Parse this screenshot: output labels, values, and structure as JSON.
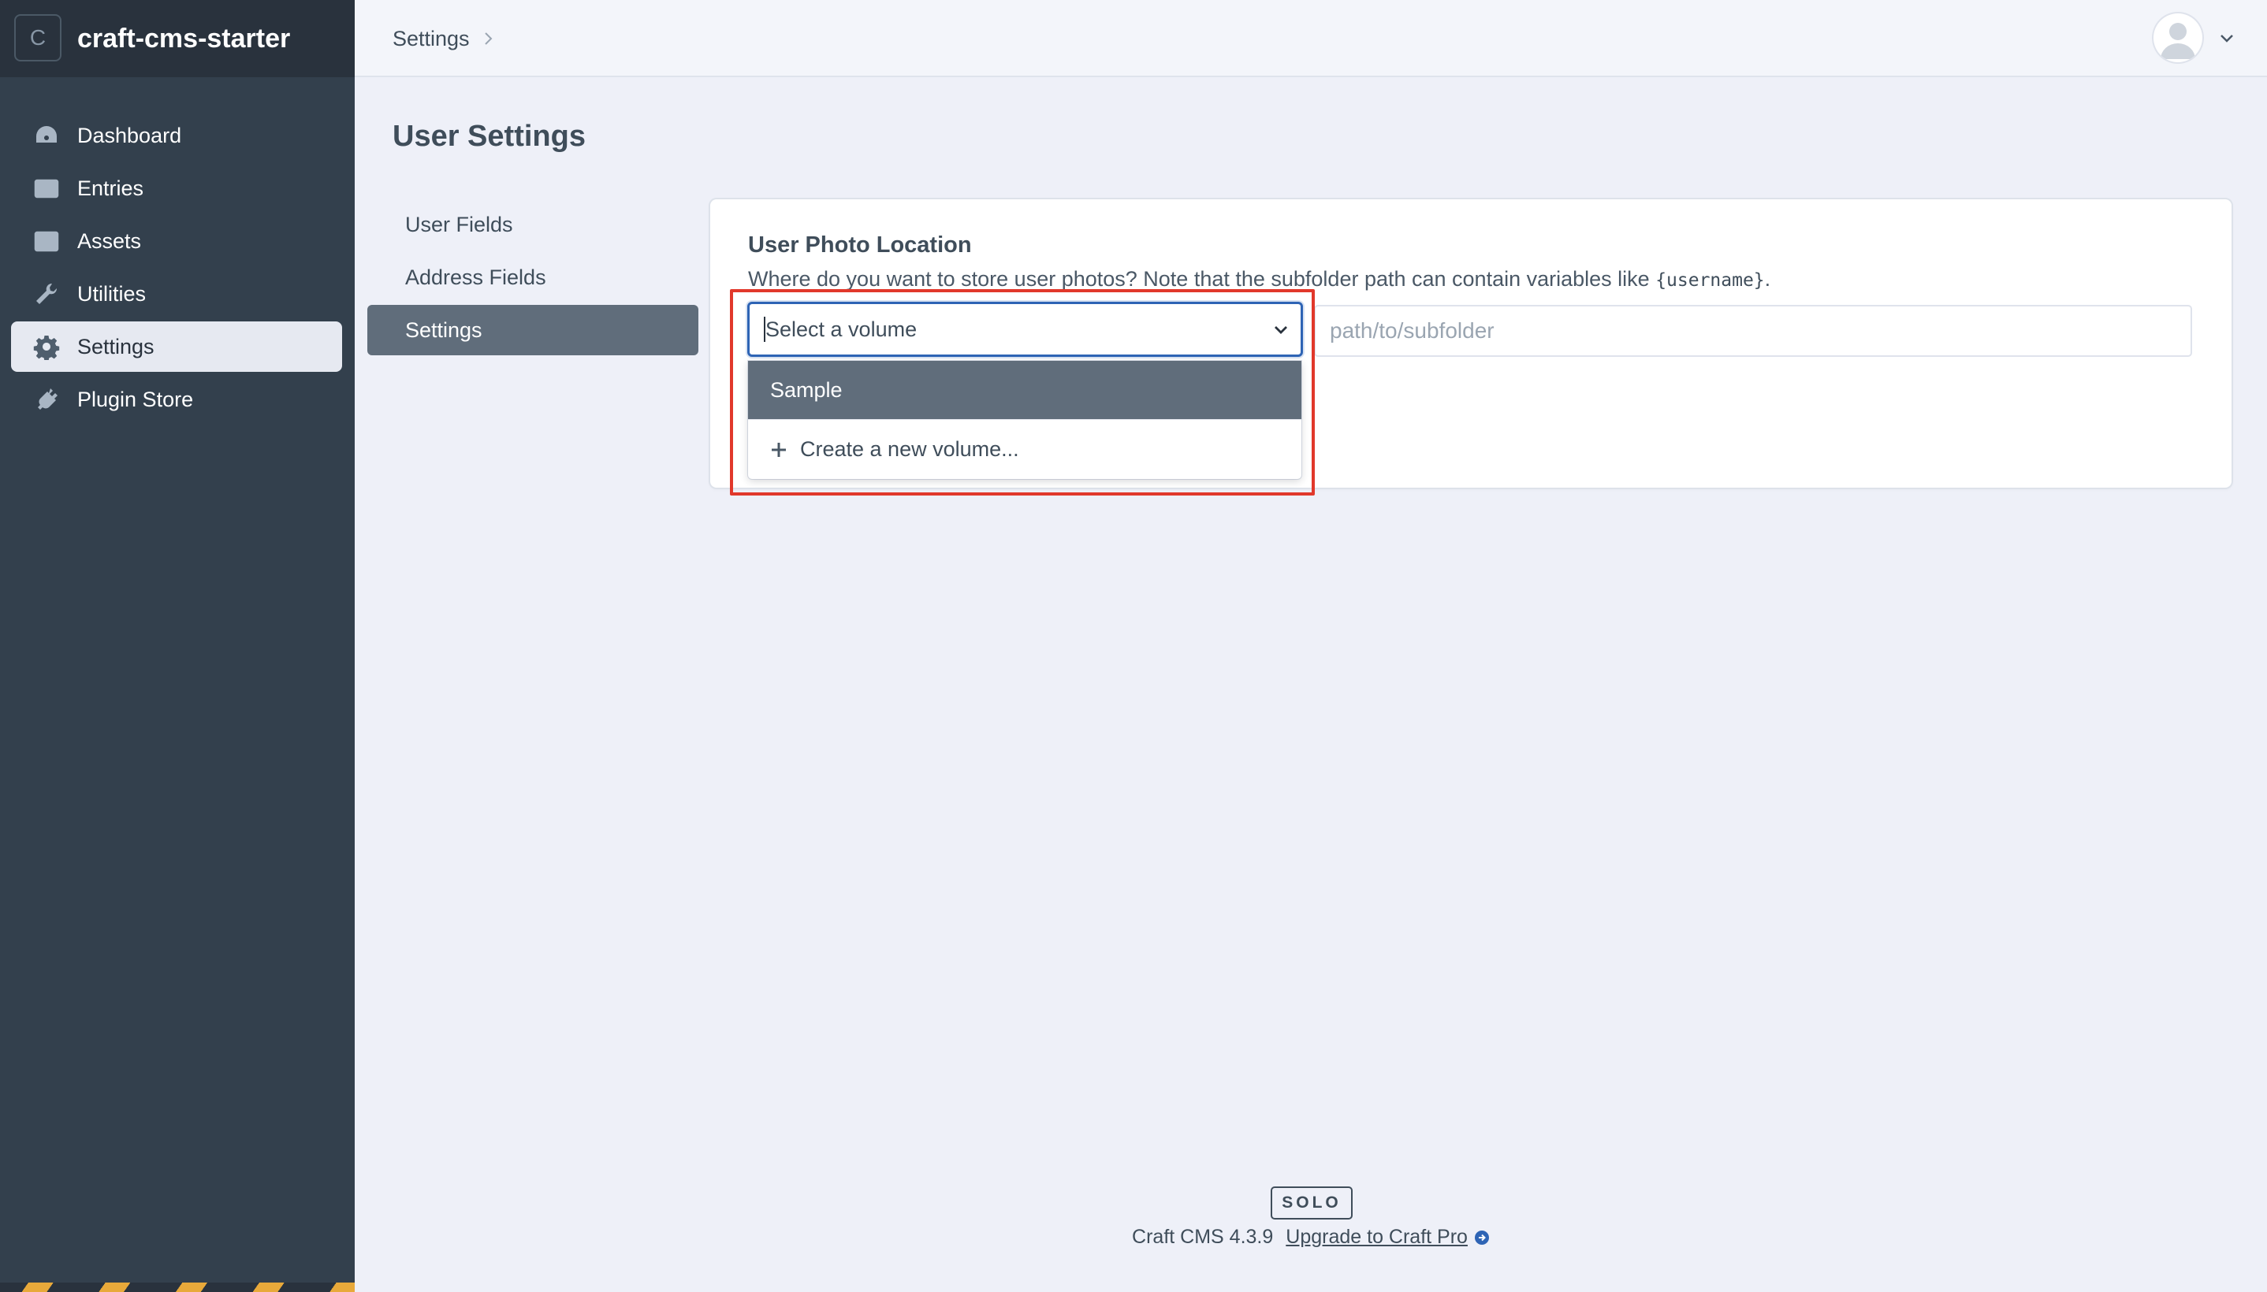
{
  "site": {
    "badge_letter": "C",
    "name": "craft-cms-starter"
  },
  "nav": {
    "items": [
      {
        "label": "Dashboard",
        "icon": "gauge-icon"
      },
      {
        "label": "Entries",
        "icon": "newspaper-icon"
      },
      {
        "label": "Assets",
        "icon": "image-icon"
      },
      {
        "label": "Utilities",
        "icon": "wrench-icon"
      },
      {
        "label": "Settings",
        "icon": "gear-icon",
        "active": true
      },
      {
        "label": "Plugin Store",
        "icon": "plug-icon"
      }
    ]
  },
  "topbar": {
    "breadcrumb": "Settings"
  },
  "page": {
    "title": "User Settings"
  },
  "subnav": {
    "items": [
      {
        "label": "User Fields"
      },
      {
        "label": "Address Fields"
      },
      {
        "label": "Settings",
        "active": true
      }
    ]
  },
  "photo_location": {
    "label": "User Photo Location",
    "instructions_prefix": "Where do you want to store user photos? Note that the subfolder path can contain variables like ",
    "instructions_code": "{username}",
    "instructions_suffix": ".",
    "volume_select": {
      "value": "Select a volume"
    },
    "subfolder": {
      "placeholder": "path/to/subfolder",
      "value": ""
    },
    "dropdown_options": [
      {
        "label": "Sample",
        "highlighted": true
      },
      {
        "label": "Create a new volume..."
      }
    ]
  },
  "footer": {
    "edition": "SOLO",
    "version": "Craft CMS 4.3.9",
    "upgrade_link": "Upgrade to Craft Pro"
  },
  "colors": {
    "sidebar_bg": "#33404d",
    "accent_focus": "#2e64b5",
    "highlight_box": "#e1382b",
    "active_subnav": "#606d7b"
  }
}
